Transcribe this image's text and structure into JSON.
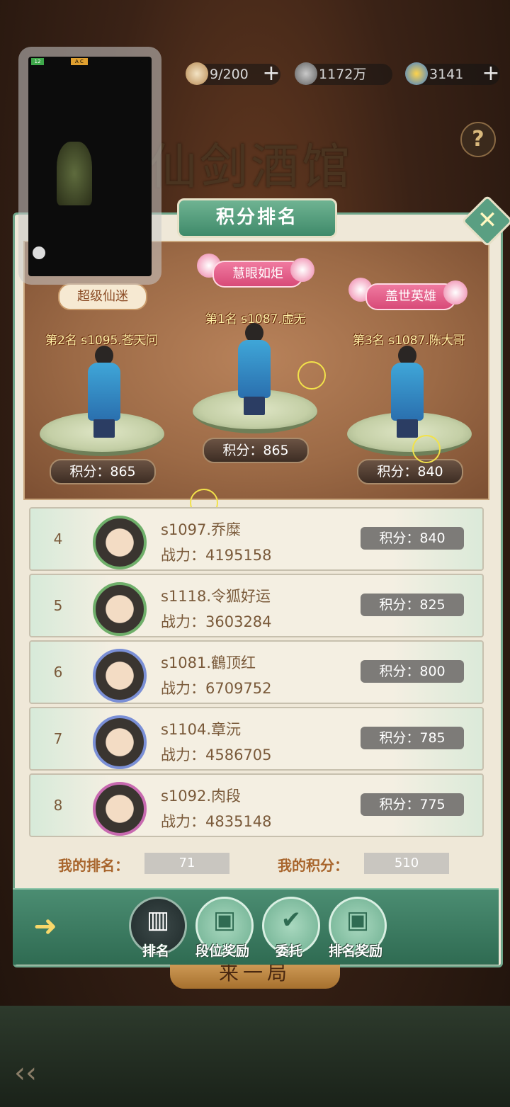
{
  "header": {
    "stamina": "9/200",
    "coins": "1172万",
    "gems": "3141",
    "game_title": "仙剑酒馆"
  },
  "panel": {
    "title": "积分排名"
  },
  "mini_window": {
    "level": "12",
    "badge": "A C"
  },
  "podium": {
    "first": {
      "title": "慧眼如炬",
      "rank": "第1名",
      "name": "s1087.虚无",
      "score": "积分：865"
    },
    "second": {
      "title": "超级仙迷",
      "rank": "第2名",
      "name": "s1095.苍天问",
      "score": "积分：865"
    },
    "third": {
      "title": "盖世英雄",
      "rank": "第3名",
      "name": "s1087.陈大哥",
      "score": "积分：840"
    }
  },
  "list": [
    {
      "rank": "4",
      "name": "s1097.乔糜",
      "power": "战力：4195158",
      "score": "积分：840"
    },
    {
      "rank": "5",
      "name": "s1118.令狐好运",
      "power": "战力：3603284",
      "score": "积分：825"
    },
    {
      "rank": "6",
      "name": "s1081.鶴顶红",
      "power": "战力：6709752",
      "score": "积分：800"
    },
    {
      "rank": "7",
      "name": "s1104.章沅",
      "power": "战力：4586705",
      "score": "积分：785"
    },
    {
      "rank": "8",
      "name": "s1092.肉段",
      "power": "战力：4835148",
      "score": "积分：775"
    }
  ],
  "mine": {
    "rank_label": "我的排名：",
    "rank_value": "71",
    "score_label": "我的积分：",
    "score_value": "510"
  },
  "tabs": [
    {
      "label": "排名"
    },
    {
      "label": "段位奖励"
    },
    {
      "label": "委托"
    },
    {
      "label": "排名奖励"
    }
  ],
  "play_button": "来一局",
  "colors": {
    "accent_green": "#4b8d72",
    "pink_title": "#d84a78",
    "score_gray": "#7d7b78"
  }
}
